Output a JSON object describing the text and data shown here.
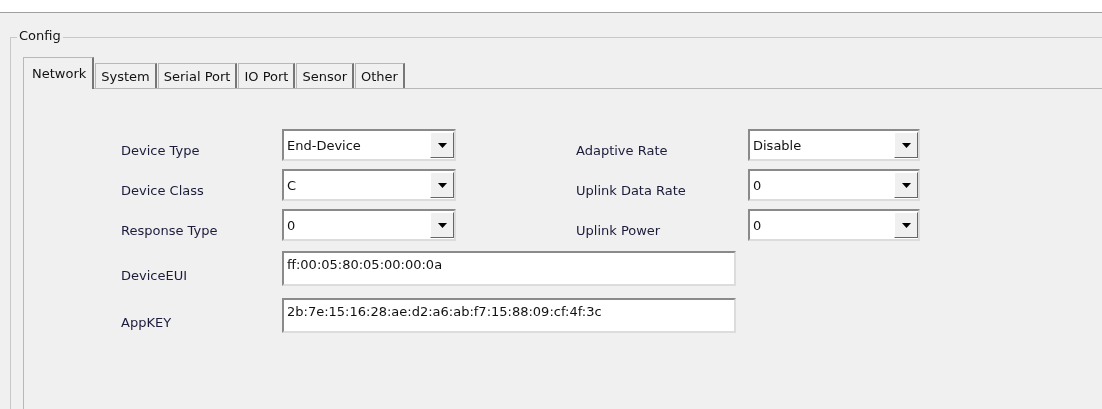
{
  "group": {
    "title": "Config"
  },
  "tabs": [
    {
      "label": "Network",
      "selected": true
    },
    {
      "label": "System",
      "selected": false
    },
    {
      "label": "Serial Port",
      "selected": false
    },
    {
      "label": "IO Port",
      "selected": false
    },
    {
      "label": "Sensor",
      "selected": false
    },
    {
      "label": "Other",
      "selected": false
    }
  ],
  "left_fields": [
    {
      "label": "Device Type",
      "value": "End-Device"
    },
    {
      "label": "Device Class",
      "value": "C"
    },
    {
      "label": "Response Type",
      "value": "0"
    }
  ],
  "right_fields": [
    {
      "label": "Adaptive Rate",
      "value": "Disable"
    },
    {
      "label": "Uplink Data Rate",
      "value": "0"
    },
    {
      "label": "Uplink Power",
      "value": "0"
    }
  ],
  "text_fields": [
    {
      "label": "DeviceEUI",
      "value": "ff:00:05:80:05:00:00:0a"
    },
    {
      "label": "AppKEY",
      "value": "2b:7e:15:16:28:ae:d2:a6:ab:f7:15:88:09:cf:4f:3c"
    }
  ]
}
